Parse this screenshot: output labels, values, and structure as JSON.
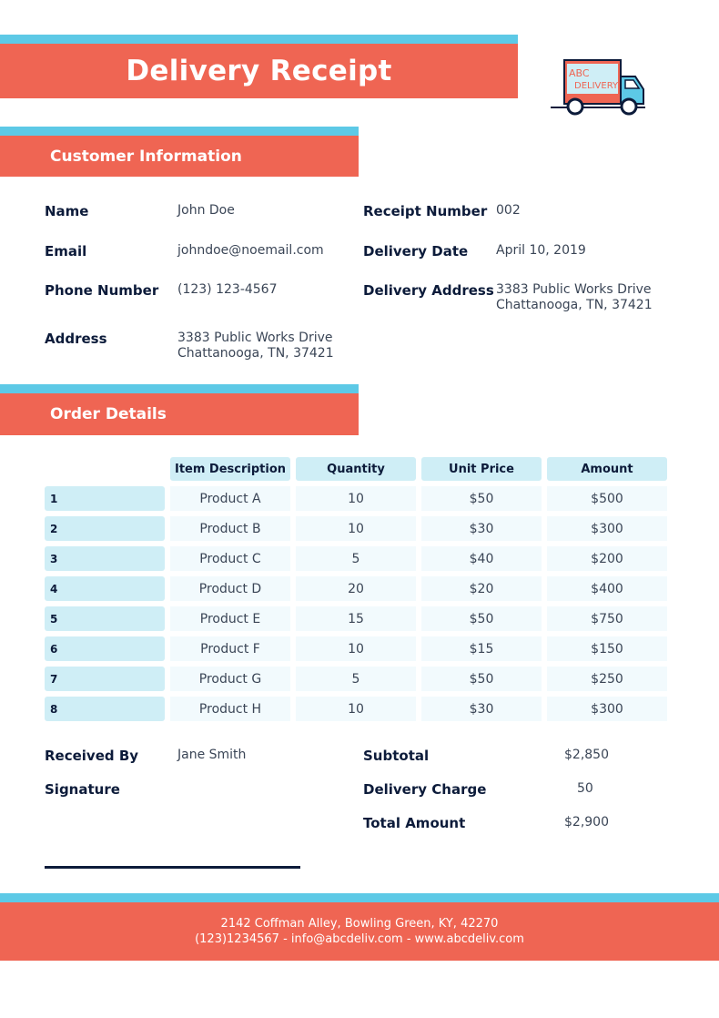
{
  "title": "Delivery Receipt",
  "logo": {
    "line1": "ABC",
    "line2": "DELIVERY"
  },
  "customer_section": {
    "heading": "Customer Information",
    "name_label": "Name",
    "name": "John Doe",
    "email_label": "Email",
    "email": "johndoe@noemail.com",
    "phone_label": "Phone Number",
    "phone": "(123) 123-4567",
    "address_label": "Address",
    "address_line1": "3383 Public Works Drive",
    "address_line2": "Chattanooga, TN, 37421",
    "receipt_label": "Receipt Number",
    "receipt": "002",
    "date_label": "Delivery Date",
    "date": "April 10, 2019",
    "delivery_address_label": "Delivery Address",
    "delivery_address_line1": "3383 Public Works Drive",
    "delivery_address_line2": "Chattanooga, TN, 37421"
  },
  "order_section": {
    "heading": "Order Details",
    "columns": [
      "Item Description",
      "Quantity",
      "Unit Price",
      "Amount"
    ],
    "rows": [
      {
        "num": "1",
        "item": "Product A",
        "qty": "10",
        "price": "$50",
        "amount": "$500"
      },
      {
        "num": "2",
        "item": "Product B",
        "qty": "10",
        "price": "$30",
        "amount": "$300"
      },
      {
        "num": "3",
        "item": "Product C",
        "qty": "5",
        "price": "$40",
        "amount": "$200"
      },
      {
        "num": "4",
        "item": "Product D",
        "qty": "20",
        "price": "$20",
        "amount": "$400"
      },
      {
        "num": "5",
        "item": "Product E",
        "qty": "15",
        "price": "$50",
        "amount": "$750"
      },
      {
        "num": "6",
        "item": "Product F",
        "qty": "10",
        "price": "$15",
        "amount": "$150"
      },
      {
        "num": "7",
        "item": "Product G",
        "qty": "5",
        "price": "$50",
        "amount": "$250"
      },
      {
        "num": "8",
        "item": "Product H",
        "qty": "10",
        "price": "$30",
        "amount": "$300"
      }
    ]
  },
  "summary": {
    "received_by_label": "Received By",
    "received_by": "Jane Smith",
    "signature_label": "Signature",
    "subtotal_label": "Subtotal",
    "subtotal": "$2,850",
    "delivery_charge_label": "Delivery Charge",
    "delivery_charge": "50",
    "total_label": "Total Amount",
    "total": "$2,900"
  },
  "footer": {
    "line1": "2142 Coffman Alley, Bowling Green, KY, 42270",
    "line2": "(123)1234567 - info@abcdeliv.com - www.abcdeliv.com"
  },
  "colors": {
    "coral": "#ef6553",
    "cyan": "#5dc9e6",
    "light_cyan": "#cfeef6",
    "navy": "#0c1b3a"
  }
}
